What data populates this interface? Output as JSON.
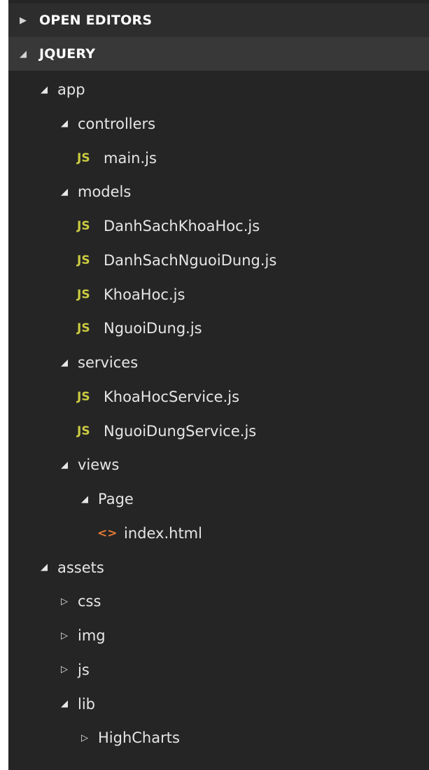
{
  "colors": {
    "panel_bg": "#252526",
    "header_bg": "#383838",
    "js_icon": "#cbcb41",
    "html_icon": "#e37933",
    "text": "#e6e6e6"
  },
  "sections": {
    "open_editors": {
      "label": "OPEN EDITORS",
      "expanded": false
    },
    "project": {
      "label": "JQUERY",
      "expanded": true
    }
  },
  "glyphs": {
    "expanded": "◢",
    "collapsed": "▷",
    "js": "JS",
    "html": "<>"
  },
  "tree": [
    {
      "label": "app",
      "type": "folder",
      "expanded": true,
      "depth": 0,
      "icon": ""
    },
    {
      "label": "controllers",
      "type": "folder",
      "expanded": true,
      "depth": 1,
      "icon": ""
    },
    {
      "label": "main.js",
      "type": "file",
      "depth": 2,
      "icon": "js-file-icon"
    },
    {
      "label": "models",
      "type": "folder",
      "expanded": true,
      "depth": 1,
      "icon": ""
    },
    {
      "label": "DanhSachKhoaHoc.js",
      "type": "file",
      "depth": 2,
      "icon": "js-file-icon"
    },
    {
      "label": "DanhSachNguoiDung.js",
      "type": "file",
      "depth": 2,
      "icon": "js-file-icon"
    },
    {
      "label": "KhoaHoc.js",
      "type": "file",
      "depth": 2,
      "icon": "js-file-icon"
    },
    {
      "label": "NguoiDung.js",
      "type": "file",
      "depth": 2,
      "icon": "js-file-icon"
    },
    {
      "label": "services",
      "type": "folder",
      "expanded": true,
      "depth": 1,
      "icon": ""
    },
    {
      "label": "KhoaHocService.js",
      "type": "file",
      "depth": 2,
      "icon": "js-file-icon"
    },
    {
      "label": "NguoiDungService.js",
      "type": "file",
      "depth": 2,
      "icon": "js-file-icon"
    },
    {
      "label": "views",
      "type": "folder",
      "expanded": true,
      "depth": 1,
      "icon": ""
    },
    {
      "label": "Page",
      "type": "folder",
      "expanded": true,
      "depth": 2,
      "icon": ""
    },
    {
      "label": "index.html",
      "type": "file",
      "depth": 3,
      "icon": "html-file-icon"
    },
    {
      "label": "assets",
      "type": "folder",
      "expanded": true,
      "depth": 0,
      "icon": ""
    },
    {
      "label": "css",
      "type": "folder",
      "expanded": false,
      "depth": 1,
      "icon": ""
    },
    {
      "label": "img",
      "type": "folder",
      "expanded": false,
      "depth": 1,
      "icon": ""
    },
    {
      "label": "js",
      "type": "folder",
      "expanded": false,
      "depth": 1,
      "icon": ""
    },
    {
      "label": "lib",
      "type": "folder",
      "expanded": true,
      "depth": 1,
      "icon": ""
    },
    {
      "label": "HighCharts",
      "type": "folder",
      "expanded": false,
      "depth": 2,
      "icon": ""
    }
  ]
}
